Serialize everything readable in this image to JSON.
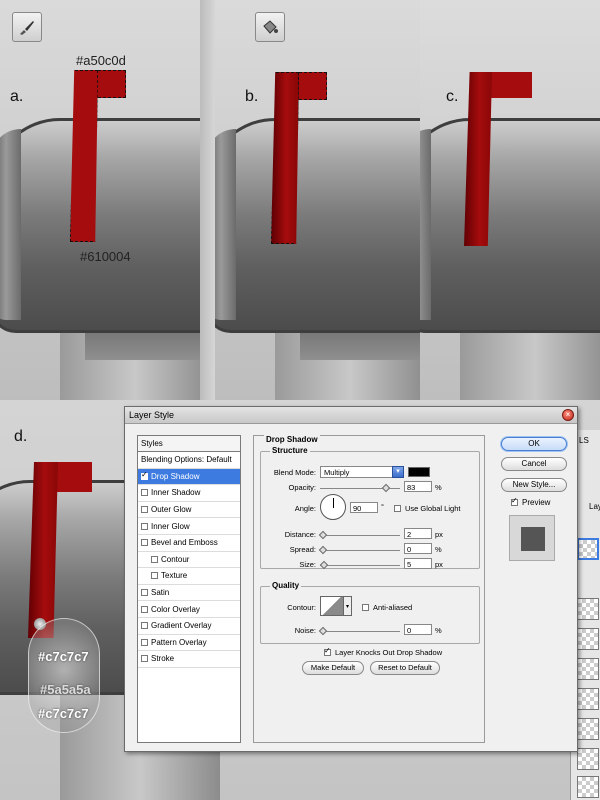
{
  "tutorial": {
    "steps": [
      "a.",
      "b.",
      "c.",
      "d."
    ],
    "flag_top_color": "#a50c0d",
    "flag_bottom_color": "#610004",
    "magnifier_colors": [
      "#c7c7c7",
      "#5a5a5a",
      "#c7c7c7"
    ],
    "tools": [
      "brush-icon",
      "paint-bucket-icon"
    ]
  },
  "dialog": {
    "title": "Layer Style",
    "styles_header": "Styles",
    "style_items": [
      {
        "label": "Blending Options: Default",
        "checkbox": false,
        "checked": false,
        "indent": false
      },
      {
        "label": "Drop Shadow",
        "checkbox": true,
        "checked": true,
        "indent": false
      },
      {
        "label": "Inner Shadow",
        "checkbox": true,
        "checked": false,
        "indent": false
      },
      {
        "label": "Outer Glow",
        "checkbox": true,
        "checked": false,
        "indent": false
      },
      {
        "label": "Inner Glow",
        "checkbox": true,
        "checked": false,
        "indent": false
      },
      {
        "label": "Bevel and Emboss",
        "checkbox": true,
        "checked": false,
        "indent": false
      },
      {
        "label": "Contour",
        "checkbox": true,
        "checked": false,
        "indent": true
      },
      {
        "label": "Texture",
        "checkbox": true,
        "checked": false,
        "indent": true
      },
      {
        "label": "Satin",
        "checkbox": true,
        "checked": false,
        "indent": false
      },
      {
        "label": "Color Overlay",
        "checkbox": true,
        "checked": false,
        "indent": false
      },
      {
        "label": "Gradient Overlay",
        "checkbox": true,
        "checked": false,
        "indent": false
      },
      {
        "label": "Pattern Overlay",
        "checkbox": true,
        "checked": false,
        "indent": false
      },
      {
        "label": "Stroke",
        "checkbox": true,
        "checked": false,
        "indent": false
      }
    ],
    "selected_style": "Drop Shadow",
    "section_title": "Drop Shadow",
    "structure": {
      "title": "Structure",
      "blend_mode_label": "Blend Mode:",
      "blend_mode_value": "Multiply",
      "shadow_color": "#000000",
      "opacity_label": "Opacity:",
      "opacity_value": "83",
      "opacity_unit": "%",
      "angle_label": "Angle:",
      "angle_value": "90",
      "angle_unit": "°",
      "use_global_light_label": "Use Global Light",
      "use_global_light": false,
      "distance_label": "Distance:",
      "distance_value": "2",
      "distance_unit": "px",
      "spread_label": "Spread:",
      "spread_value": "0",
      "spread_unit": "%",
      "size_label": "Size:",
      "size_value": "5",
      "size_unit": "px"
    },
    "quality": {
      "title": "Quality",
      "contour_label": "Contour:",
      "anti_aliased_label": "Anti-aliased",
      "anti_aliased": false,
      "noise_label": "Noise:",
      "noise_value": "0",
      "noise_unit": "%"
    },
    "knocks_out_label": "Layer Knocks Out Drop Shadow",
    "knocks_out": true,
    "make_default_label": "Make Default",
    "reset_default_label": "Reset to Default",
    "ok_label": "OK",
    "cancel_label": "Cancel",
    "new_style_label": "New Style...",
    "preview_label": "Preview",
    "preview": true
  },
  "layers_panel": {
    "tab_fragment": "LS",
    "item_fragment": "Lay"
  }
}
